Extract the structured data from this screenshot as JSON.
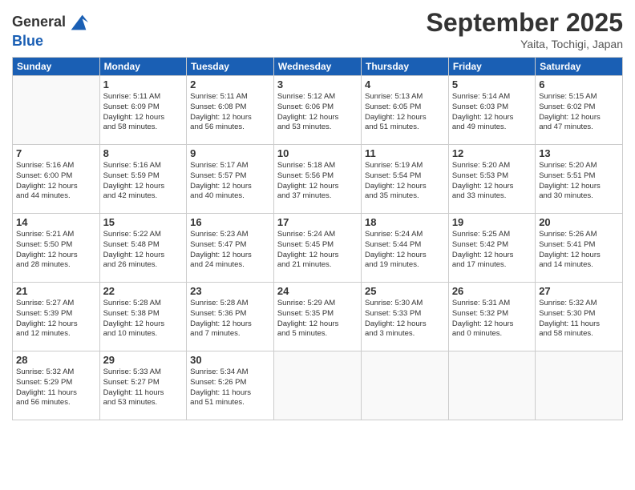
{
  "header": {
    "logo_line1": "General",
    "logo_line2": "Blue",
    "month": "September 2025",
    "location": "Yaita, Tochigi, Japan"
  },
  "weekdays": [
    "Sunday",
    "Monday",
    "Tuesday",
    "Wednesday",
    "Thursday",
    "Friday",
    "Saturday"
  ],
  "weeks": [
    [
      {
        "day": "",
        "info": ""
      },
      {
        "day": "1",
        "info": "Sunrise: 5:11 AM\nSunset: 6:09 PM\nDaylight: 12 hours\nand 58 minutes."
      },
      {
        "day": "2",
        "info": "Sunrise: 5:11 AM\nSunset: 6:08 PM\nDaylight: 12 hours\nand 56 minutes."
      },
      {
        "day": "3",
        "info": "Sunrise: 5:12 AM\nSunset: 6:06 PM\nDaylight: 12 hours\nand 53 minutes."
      },
      {
        "day": "4",
        "info": "Sunrise: 5:13 AM\nSunset: 6:05 PM\nDaylight: 12 hours\nand 51 minutes."
      },
      {
        "day": "5",
        "info": "Sunrise: 5:14 AM\nSunset: 6:03 PM\nDaylight: 12 hours\nand 49 minutes."
      },
      {
        "day": "6",
        "info": "Sunrise: 5:15 AM\nSunset: 6:02 PM\nDaylight: 12 hours\nand 47 minutes."
      }
    ],
    [
      {
        "day": "7",
        "info": "Sunrise: 5:16 AM\nSunset: 6:00 PM\nDaylight: 12 hours\nand 44 minutes."
      },
      {
        "day": "8",
        "info": "Sunrise: 5:16 AM\nSunset: 5:59 PM\nDaylight: 12 hours\nand 42 minutes."
      },
      {
        "day": "9",
        "info": "Sunrise: 5:17 AM\nSunset: 5:57 PM\nDaylight: 12 hours\nand 40 minutes."
      },
      {
        "day": "10",
        "info": "Sunrise: 5:18 AM\nSunset: 5:56 PM\nDaylight: 12 hours\nand 37 minutes."
      },
      {
        "day": "11",
        "info": "Sunrise: 5:19 AM\nSunset: 5:54 PM\nDaylight: 12 hours\nand 35 minutes."
      },
      {
        "day": "12",
        "info": "Sunrise: 5:20 AM\nSunset: 5:53 PM\nDaylight: 12 hours\nand 33 minutes."
      },
      {
        "day": "13",
        "info": "Sunrise: 5:20 AM\nSunset: 5:51 PM\nDaylight: 12 hours\nand 30 minutes."
      }
    ],
    [
      {
        "day": "14",
        "info": "Sunrise: 5:21 AM\nSunset: 5:50 PM\nDaylight: 12 hours\nand 28 minutes."
      },
      {
        "day": "15",
        "info": "Sunrise: 5:22 AM\nSunset: 5:48 PM\nDaylight: 12 hours\nand 26 minutes."
      },
      {
        "day": "16",
        "info": "Sunrise: 5:23 AM\nSunset: 5:47 PM\nDaylight: 12 hours\nand 24 minutes."
      },
      {
        "day": "17",
        "info": "Sunrise: 5:24 AM\nSunset: 5:45 PM\nDaylight: 12 hours\nand 21 minutes."
      },
      {
        "day": "18",
        "info": "Sunrise: 5:24 AM\nSunset: 5:44 PM\nDaylight: 12 hours\nand 19 minutes."
      },
      {
        "day": "19",
        "info": "Sunrise: 5:25 AM\nSunset: 5:42 PM\nDaylight: 12 hours\nand 17 minutes."
      },
      {
        "day": "20",
        "info": "Sunrise: 5:26 AM\nSunset: 5:41 PM\nDaylight: 12 hours\nand 14 minutes."
      }
    ],
    [
      {
        "day": "21",
        "info": "Sunrise: 5:27 AM\nSunset: 5:39 PM\nDaylight: 12 hours\nand 12 minutes."
      },
      {
        "day": "22",
        "info": "Sunrise: 5:28 AM\nSunset: 5:38 PM\nDaylight: 12 hours\nand 10 minutes."
      },
      {
        "day": "23",
        "info": "Sunrise: 5:28 AM\nSunset: 5:36 PM\nDaylight: 12 hours\nand 7 minutes."
      },
      {
        "day": "24",
        "info": "Sunrise: 5:29 AM\nSunset: 5:35 PM\nDaylight: 12 hours\nand 5 minutes."
      },
      {
        "day": "25",
        "info": "Sunrise: 5:30 AM\nSunset: 5:33 PM\nDaylight: 12 hours\nand 3 minutes."
      },
      {
        "day": "26",
        "info": "Sunrise: 5:31 AM\nSunset: 5:32 PM\nDaylight: 12 hours\nand 0 minutes."
      },
      {
        "day": "27",
        "info": "Sunrise: 5:32 AM\nSunset: 5:30 PM\nDaylight: 11 hours\nand 58 minutes."
      }
    ],
    [
      {
        "day": "28",
        "info": "Sunrise: 5:32 AM\nSunset: 5:29 PM\nDaylight: 11 hours\nand 56 minutes."
      },
      {
        "day": "29",
        "info": "Sunrise: 5:33 AM\nSunset: 5:27 PM\nDaylight: 11 hours\nand 53 minutes."
      },
      {
        "day": "30",
        "info": "Sunrise: 5:34 AM\nSunset: 5:26 PM\nDaylight: 11 hours\nand 51 minutes."
      },
      {
        "day": "",
        "info": ""
      },
      {
        "day": "",
        "info": ""
      },
      {
        "day": "",
        "info": ""
      },
      {
        "day": "",
        "info": ""
      }
    ]
  ]
}
